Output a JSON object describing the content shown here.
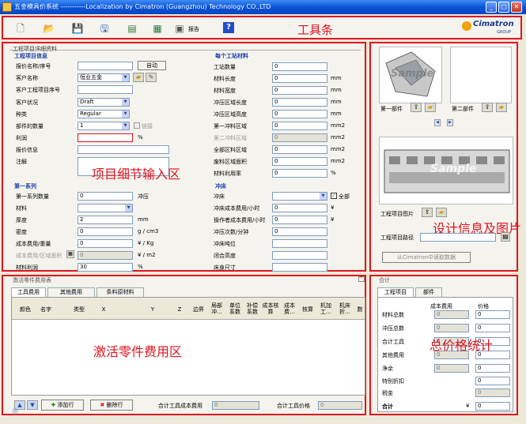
{
  "window": {
    "title": "五金模具价系统 -----------Localization by Cimatron (Guangzhou) Technology CO.,LTD",
    "min": "_",
    "max": "□",
    "close": "✕"
  },
  "toolbar": {
    "report_label": "报告",
    "help_label": "?",
    "brand": "Cimatron",
    "brand_sub": "GROUP",
    "annotation": "工具条"
  },
  "info": {
    "frame_title": "工程项目详细资料",
    "sec_project": "工程项目信息",
    "quote_no_label": "报价名称/序号",
    "auto_btn": "自动",
    "customer_label": "客户名称",
    "customer_value": "恒业五金",
    "cust_proj_label": "客户工程项目序号",
    "cust_status_label": "客户状况",
    "cust_status_value": "Draft",
    "type_label": "种类",
    "type_value": "Regular",
    "part_qty_label": "部件的数量",
    "part_qty_value": "1",
    "link_label": "链接",
    "profit_label": "利润",
    "profit_unit": "%",
    "quote_info_label": "报价信息",
    "note_label": "注解",
    "sec_material": "每个工站材料",
    "station_label": "工站数量",
    "station_value": "0",
    "mat_len_label": "材料长度",
    "mat_len_value": "0",
    "mat_len_unit": "mm",
    "mat_wid_label": "材料宽度",
    "mat_wid_value": "0",
    "mat_wid_unit": "mm",
    "punch_len_label": "冲压区域长度",
    "punch_len_value": "0",
    "punch_len_unit": "mm",
    "punch_wid_label": "冲压区域高度",
    "punch_wid_value": "0",
    "punch_wid_unit": "mm",
    "area1_label": "第一冲料区域",
    "area1_value": "0",
    "area1_unit": "mm2",
    "area2_label": "第二冲料区域",
    "area2_value": "0",
    "area2_unit": "mm2",
    "total_area_label": "全部区料区域",
    "total_area_value": "0",
    "total_area_unit": "mm2",
    "waste_area_label": "废料区域面积",
    "waste_area_value": "0",
    "waste_area_unit": "mm2",
    "util_label": "材料利用率",
    "util_value": "0",
    "util_unit": "%",
    "sec_series": "第一系列",
    "series_qty_label": "第一系列数量",
    "series_qty_value": "0",
    "series_qty_unit": "冲压",
    "material_label": "材料",
    "thick_label": "厚度",
    "thick_value": "2",
    "thick_unit": "mm",
    "density_label": "密度",
    "density_value": "0",
    "density_unit": "g / cm3",
    "cost_wt_label": "成本费用/重量",
    "cost_wt_value": "0",
    "cost_wt_unit": "¥ / Kg",
    "cost_area_label": "成本费用/区域面积",
    "cost_area_value": "0",
    "cost_area_unit": "¥ / m2",
    "mat_profit_label": "材料利润",
    "mat_profit_value": "30",
    "mat_profit_unit": "%",
    "sec_press": "冲床",
    "press_label": "冲床",
    "all_label": "全部",
    "press_cost_hr_label": "冲床成本费用/小时",
    "press_cost_hr_value": "0",
    "press_cost_hr_unit": "¥",
    "op_cost_hr_label": "操作者成本费用/小时",
    "op_cost_hr_value": "0",
    "op_cost_hr_unit": "¥",
    "strokes_label": "冲压次数/分钟",
    "strokes_value": "0",
    "tonnage_label": "冲床吨位",
    "shut_h_label": "闭合高度",
    "bed_size_label": "床身尺寸",
    "annotation": "项目细节输入区"
  },
  "design": {
    "part1_label": "第一部件",
    "part2_label": "第二部件",
    "sample": "Sample",
    "proj_img_label": "工程项目图片",
    "proj_path_label": "工程项目路径",
    "read_btn": "从Cimatron中读取数据",
    "annotation": "设计信息及图片"
  },
  "parts": {
    "frame_title": "激活零件费用表",
    "tabs": [
      "工具费用",
      "其他费用",
      "条料原材料"
    ],
    "columns": [
      "颜色",
      "名字",
      "类型",
      "X",
      "Y",
      "Z",
      "边界",
      "局部冲...",
      "单位系数",
      "补偿系数",
      "成本核算",
      "成本费...",
      "核算",
      "机加工...",
      "机床折...",
      "数"
    ],
    "add_btn": "添加行",
    "del_btn": "删除行",
    "total_cost_label": "合计工具成本费用",
    "total_cost_value": "0",
    "total_price_label": "合计工具价格",
    "total_price_value": "0",
    "annotation": "激活零件费用区"
  },
  "summary": {
    "frame_title": "合计",
    "tabs": [
      "工程项目",
      "部件"
    ],
    "col_cost": "成本费用",
    "col_price": "价格",
    "rows": [
      {
        "label": "材料总数",
        "cost": "0",
        "price": "0"
      },
      {
        "label": "冲压总数",
        "cost": "0",
        "price": "0"
      },
      {
        "label": "合计工具",
        "cost": "0",
        "price": "0"
      },
      {
        "label": "其他费用",
        "cost": "0",
        "price": "0"
      },
      {
        "label": "净余",
        "cost": "0",
        "price": "0"
      }
    ],
    "special_label": "特别折扣",
    "special_value": "0",
    "tax_label": "税金",
    "tax_value": "0",
    "total_label": "合计",
    "total_currency": "¥",
    "total_value": "0",
    "annotation": "总价格统计"
  }
}
